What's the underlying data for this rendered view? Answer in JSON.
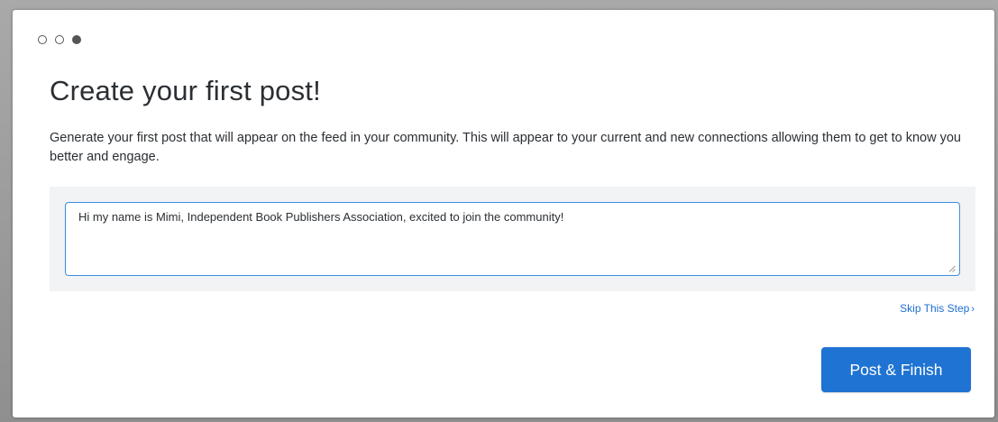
{
  "steps": {
    "total": 3,
    "current": 3
  },
  "heading": {
    "title": "Create your first post!",
    "description": "Generate your first post that will appear on the feed in your community. This will appear to your current and new connections allowing them to get to know you better and engage."
  },
  "composer": {
    "value": "Hi my name is Mimi, Independent Book Publishers Association, excited to join the community!"
  },
  "actions": {
    "skip_label": "Skip This Step",
    "skip_chevron": "›",
    "post_label": "Post & Finish"
  },
  "colors": {
    "accent": "#1f73d2",
    "input_border": "#3d8de0",
    "link": "#1e6fd0"
  }
}
